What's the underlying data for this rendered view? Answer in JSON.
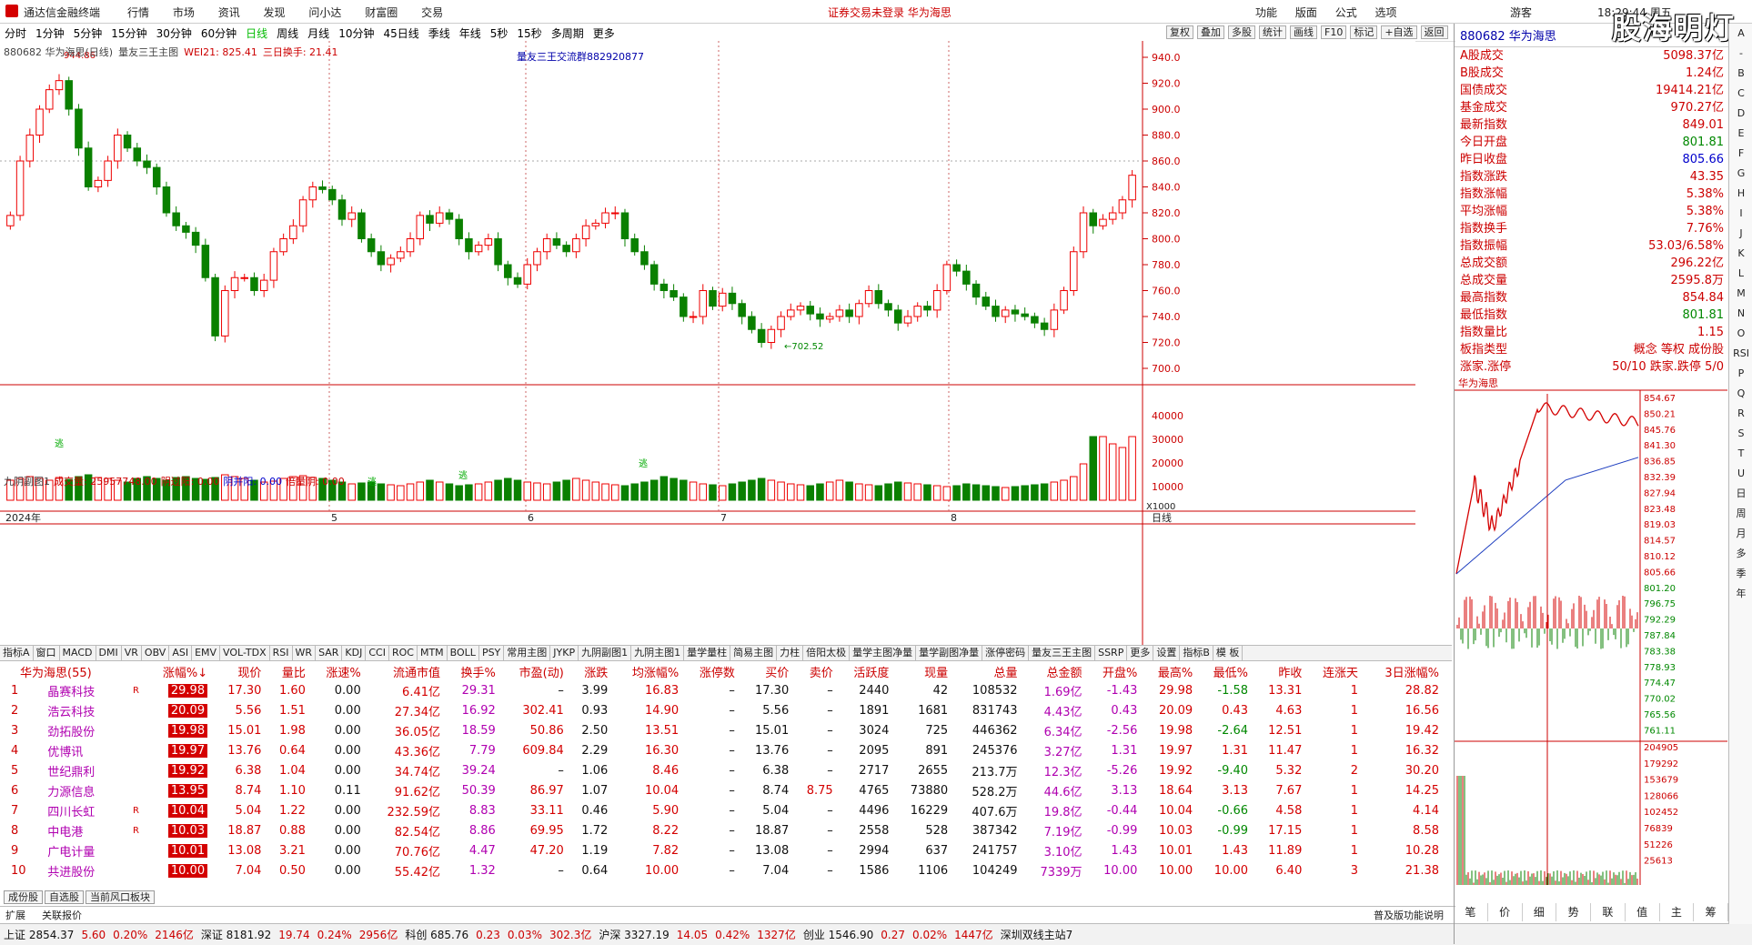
{
  "titlebar": {
    "app": "通达信金融终端",
    "menu": [
      "行情",
      "市场",
      "资讯",
      "发现",
      "问小达",
      "财富圈",
      "交易"
    ],
    "notice": "证券交易未登录  华为海思",
    "right": [
      "功能",
      "版面",
      "公式",
      "选项"
    ],
    "guest": "游客",
    "clock": "18:29:44 周五",
    "watermark": "股海明灯"
  },
  "toolbar": {
    "periods": [
      "分时",
      "1分钟",
      "5分钟",
      "15分钟",
      "30分钟",
      "60分钟",
      "日线",
      "周线",
      "月线",
      "10分钟",
      "45日线",
      "季线",
      "年线",
      "5秒",
      "15秒",
      "多周期",
      "更多"
    ],
    "active": "日线",
    "buttons": [
      "复权",
      "叠加",
      "多股",
      "统计",
      "画线",
      "F10",
      "标记",
      "+自选",
      "返回"
    ]
  },
  "chart": {
    "info": [
      "880682 华为海思(日线)",
      "量友三王主图",
      "WEI21: 825.41",
      "三日换手: 21.41"
    ],
    "qq": "量友三王交流群882920877",
    "high_label": "944.86",
    "low_label": "702.52",
    "price_ticks": [
      "940.0",
      "920.0",
      "900.0",
      "880.0",
      "860.0",
      "840.0",
      "820.0",
      "800.0",
      "780.0",
      "760.0",
      "740.0",
      "720.0",
      "700.0"
    ],
    "vol_ticks": [
      "40000",
      "30000",
      "20000",
      "10000"
    ],
    "vol_unit": "X1000",
    "sub_info": [
      "九阴副图1",
      "成交量: 25957748.00",
      "阴过阳: 0.00",
      "阴并阳: 0.00",
      "倍量阴: 0.00"
    ],
    "xlabels": [
      "2024年",
      "5",
      "6",
      "7",
      "8"
    ],
    "xlabel_line": "日线",
    "escape_marks": [
      "逃",
      "逃",
      "逃",
      "逃"
    ]
  },
  "chart_data": {
    "type": "candlestick",
    "series": [],
    "ylim": [
      700,
      945
    ]
  },
  "indicator_tabs": [
    "指标A",
    "窗口",
    "MACD",
    "DMI",
    "VR",
    "OBV",
    "ASI",
    "EMV",
    "VOL-TDX",
    "RSI",
    "WR",
    "SAR",
    "KDJ",
    "CCI",
    "ROC",
    "MTM",
    "BOLL",
    "PSY",
    "常用主图",
    "JYKP",
    "九阴副图1",
    "九阴主图1",
    "量学量柱",
    "简易主图",
    "力柱",
    "倍阳太极",
    "量学主图净量",
    "量学副图净量",
    "涨停密码",
    "量友三王主图",
    "SSRP",
    "更多",
    "设置",
    "指标B",
    "模 板"
  ],
  "table": {
    "title": "华为海思(55)",
    "headers": [
      "涨幅%↓",
      "现价",
      "量比",
      "涨速%",
      "流通市值",
      "换手%",
      "市盈(动)",
      "涨跌",
      "均涨幅%",
      "涨停数",
      "买价",
      "卖价",
      "活跃度",
      "现量",
      "总量",
      "总金额",
      "开盘%",
      "最高%",
      "最低%",
      "昨收",
      "连涨天",
      "3日涨幅%"
    ],
    "rows": [
      [
        "1",
        "晶赛科技",
        "R",
        "29.98",
        "17.30",
        "1.60",
        "0.00",
        "6.41亿",
        "29.31",
        "–",
        "3.99",
        "16.83",
        "–",
        "17.30",
        "–",
        "2440",
        "42",
        "108532",
        "1.69亿",
        "-1.43",
        "29.98",
        "-1.58",
        "13.31",
        "1",
        "28.82"
      ],
      [
        "2",
        "浩云科技",
        "",
        "20.09",
        "5.56",
        "1.51",
        "0.00",
        "27.34亿",
        "16.92",
        "302.41",
        "0.93",
        "14.90",
        "–",
        "5.56",
        "–",
        "1891",
        "1681",
        "831743",
        "4.43亿",
        "0.43",
        "20.09",
        "0.43",
        "4.63",
        "1",
        "16.56"
      ],
      [
        "3",
        "劲拓股份",
        "",
        "19.98",
        "15.01",
        "1.98",
        "0.00",
        "36.05亿",
        "18.59",
        "50.86",
        "2.50",
        "13.51",
        "–",
        "15.01",
        "–",
        "3024",
        "725",
        "446362",
        "6.34亿",
        "-2.56",
        "19.98",
        "-2.64",
        "12.51",
        "1",
        "19.42"
      ],
      [
        "4",
        "优博讯",
        "",
        "19.97",
        "13.76",
        "0.64",
        "0.00",
        "43.36亿",
        "7.79",
        "609.84",
        "2.29",
        "16.30",
        "–",
        "13.76",
        "–",
        "2095",
        "891",
        "245376",
        "3.27亿",
        "1.31",
        "19.97",
        "1.31",
        "11.47",
        "1",
        "16.32"
      ],
      [
        "5",
        "世纪鼎利",
        "",
        "19.92",
        "6.38",
        "1.04",
        "0.00",
        "34.74亿",
        "39.24",
        "–",
        "1.06",
        "8.46",
        "–",
        "6.38",
        "–",
        "2717",
        "2655",
        "213.7万",
        "12.3亿",
        "-5.26",
        "19.92",
        "-9.40",
        "5.32",
        "2",
        "30.20"
      ],
      [
        "6",
        "力源信息",
        "",
        "13.95",
        "8.74",
        "1.10",
        "0.11",
        "91.62亿",
        "50.39",
        "86.97",
        "1.07",
        "10.04",
        "–",
        "8.74",
        "8.75",
        "4765",
        "73880",
        "528.2万",
        "44.6亿",
        "3.13",
        "18.64",
        "3.13",
        "7.67",
        "1",
        "14.25"
      ],
      [
        "7",
        "四川长虹",
        "R",
        "10.04",
        "5.04",
        "1.22",
        "0.00",
        "232.59亿",
        "8.83",
        "33.11",
        "0.46",
        "5.90",
        "–",
        "5.04",
        "–",
        "4496",
        "16229",
        "407.6万",
        "19.8亿",
        "-0.44",
        "10.04",
        "-0.66",
        "4.58",
        "1",
        "4.14"
      ],
      [
        "8",
        "中电港",
        "R",
        "10.03",
        "18.87",
        "0.88",
        "0.00",
        "82.54亿",
        "8.86",
        "69.95",
        "1.72",
        "8.22",
        "–",
        "18.87",
        "–",
        "2558",
        "528",
        "387342",
        "7.19亿",
        "-0.99",
        "10.03",
        "-0.99",
        "17.15",
        "1",
        "8.58"
      ],
      [
        "9",
        "广电计量",
        "",
        "10.01",
        "13.08",
        "3.21",
        "0.00",
        "70.76亿",
        "4.47",
        "47.20",
        "1.19",
        "7.82",
        "–",
        "13.08",
        "–",
        "2994",
        "637",
        "241757",
        "3.10亿",
        "1.43",
        "10.01",
        "1.43",
        "11.89",
        "1",
        "10.28"
      ],
      [
        "10",
        "共进股份",
        "",
        "10.00",
        "7.04",
        "0.50",
        "0.00",
        "55.42亿",
        "1.32",
        "–",
        "0.64",
        "10.00",
        "–",
        "7.04",
        "–",
        "1586",
        "1106",
        "104249",
        "7339万",
        "10.00",
        "10.00",
        "10.00",
        "6.40",
        "3",
        "21.38"
      ]
    ]
  },
  "bottom_tabs": [
    "成份股",
    "自选股",
    "当前风口板块"
  ],
  "status1": {
    "left": "扩展",
    "mid": "关联报价",
    "right": "普及版功能说明"
  },
  "status2": [
    "上证 2854.37",
    "5.60",
    "0.20%",
    "2146亿",
    "深证 8181.92",
    "19.74",
    "0.24%",
    "2956亿",
    "科创 685.76",
    "0.23",
    "0.03%",
    "302.3亿",
    "沪深 3327.19",
    "14.05",
    "0.42%",
    "1327亿",
    "创业 1546.90",
    "0.27",
    "0.02%",
    "1447亿",
    "深圳双线主站7"
  ],
  "rpanel": {
    "header": "880682 华为海思",
    "rows": [
      [
        "A股成交",
        "5098.37亿",
        "v"
      ],
      [
        "B股成交",
        "1.24亿",
        "v"
      ],
      [
        "国债成交",
        "19414.21亿",
        "v"
      ],
      [
        "基金成交",
        "970.27亿",
        "v"
      ],
      [
        "最新指数",
        "849.01",
        "v"
      ],
      [
        "今日开盘",
        "801.81",
        "vg"
      ],
      [
        "昨日收盘",
        "805.66",
        "vb"
      ],
      [
        "指数涨跌",
        "43.35",
        "v"
      ],
      [
        "指数涨幅",
        "5.38%",
        "v"
      ],
      [
        "平均涨幅",
        "5.38%",
        "v"
      ],
      [
        "指数换手",
        "7.76%",
        "v"
      ],
      [
        "指数振幅",
        "53.03/6.58%",
        "v"
      ],
      [
        "总成交额",
        "296.22亿",
        "v"
      ],
      [
        "总成交量",
        "2595.8万",
        "v"
      ],
      [
        "最高指数",
        "854.84",
        "v"
      ],
      [
        "最低指数",
        "801.81",
        "vg"
      ],
      [
        "指数量比",
        "1.15",
        "v"
      ],
      [
        "板指类型",
        "概念 等权 成份股",
        "v"
      ],
      [
        "涨家.涨停",
        "50/10 跌家.跌停 5/0",
        "v"
      ]
    ],
    "mini_title": "华为海思",
    "mini_ticks": [
      "854.67",
      "850.21",
      "845.76",
      "841.30",
      "836.85",
      "832.39",
      "827.94",
      "823.48",
      "819.03",
      "814.57",
      "810.12",
      "805.66",
      "801.20",
      "796.75",
      "792.29",
      "787.84",
      "783.38",
      "778.93",
      "774.47",
      "770.02",
      "765.56",
      "761.11"
    ],
    "vol_ticks": [
      "204905",
      "179292",
      "153679",
      "128066",
      "102452",
      "76839",
      "51226",
      "25613"
    ],
    "bottom": [
      "笔",
      "价",
      "细",
      "势",
      "联",
      "值",
      "主",
      "筹"
    ]
  },
  "sidebar": [
    "A",
    "-",
    "B",
    "C",
    "D",
    "E",
    "F",
    "G",
    "H",
    "I",
    "J",
    "K",
    "L",
    "M",
    "N",
    "O",
    "RSI",
    "P",
    "Q",
    "R",
    "S",
    "T",
    "U",
    "日",
    "周",
    "月",
    "多",
    "季",
    "年"
  ]
}
